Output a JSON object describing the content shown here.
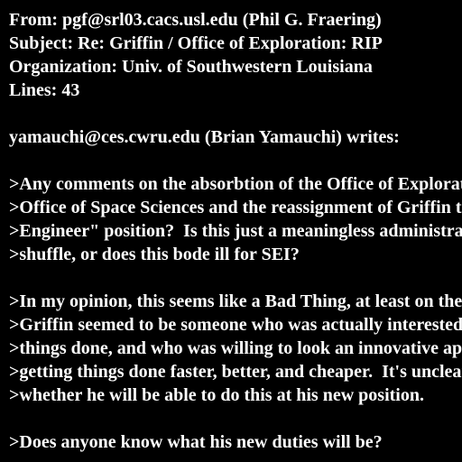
{
  "header": {
    "from": "From: pgf@srl03.cacs.usl.edu (Phil G. Fraering)",
    "subject": "Subject: Re: Griffin / Office of Exploration: RIP",
    "organization": "Organization: Univ. of Southwestern Louisiana",
    "lines": "Lines: 43"
  },
  "body": {
    "attribution": "yamauchi@ces.cwru.edu (Brian Yamauchi) writes:",
    "quote1": [
      ">Any comments on the absorbtion of the Office of Exploration into the",
      ">Office of Space Sciences and the reassignment of Griffin to the \"Chief",
      ">Engineer\" position?  Is this just a meaningless administrative",
      ">shuffle, or does this bode ill for SEI?"
    ],
    "quote2": [
      ">In my opinion, this seems like a Bad Thing, at least on the surface.",
      ">Griffin seemed to be someone who was actually interested in getting",
      ">things done, and who was willing to look an innovative approaches to",
      ">getting things done faster, better, and cheaper.  It's unclear to me",
      ">whether he will be able to do this at his new position."
    ],
    "quote3": [
      ">Does anyone know what his new duties will be?"
    ]
  }
}
